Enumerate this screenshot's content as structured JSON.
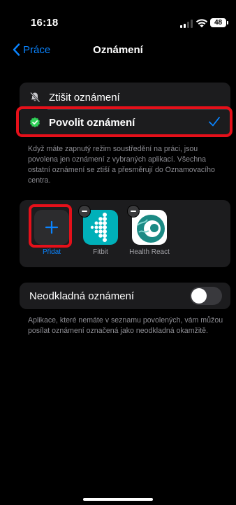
{
  "status_bar": {
    "time": "16:18",
    "battery": "48"
  },
  "nav": {
    "back_label": "Práce",
    "title": "Oznámení"
  },
  "mode_options": {
    "items": [
      {
        "label": "Ztišit oznámení",
        "icon": "bell-slash-icon",
        "selected": false
      },
      {
        "label": "Povolit oznámení",
        "icon": "shield-check-icon",
        "selected": true
      }
    ],
    "footer": "Když máte zapnutý režim soustředění na práci, jsou povolena jen oznámení z vybraných aplikací. Všechna ostatní oznámení se ztiší a přesměrují do Oznamovacího centra."
  },
  "allowed_apps": {
    "items": [
      {
        "label": "Přidat",
        "icon": "plus-icon"
      },
      {
        "label": "Fitbit",
        "icon": "fitbit-app-icon"
      },
      {
        "label": "Health React",
        "icon": "health-react-app-icon"
      }
    ]
  },
  "urgent": {
    "label": "Neodkladná oznámení",
    "enabled": false,
    "footer": "Aplikace, které nemáte v seznamu povolených, vám můžou posílat oznámení označená jako neodkladná okamžitě."
  },
  "colors": {
    "accent": "#0a84ff",
    "highlight": "#e5101a",
    "group_bg": "#1c1c1e",
    "fitbit": "#00b0b9",
    "check_green": "#30d158"
  }
}
